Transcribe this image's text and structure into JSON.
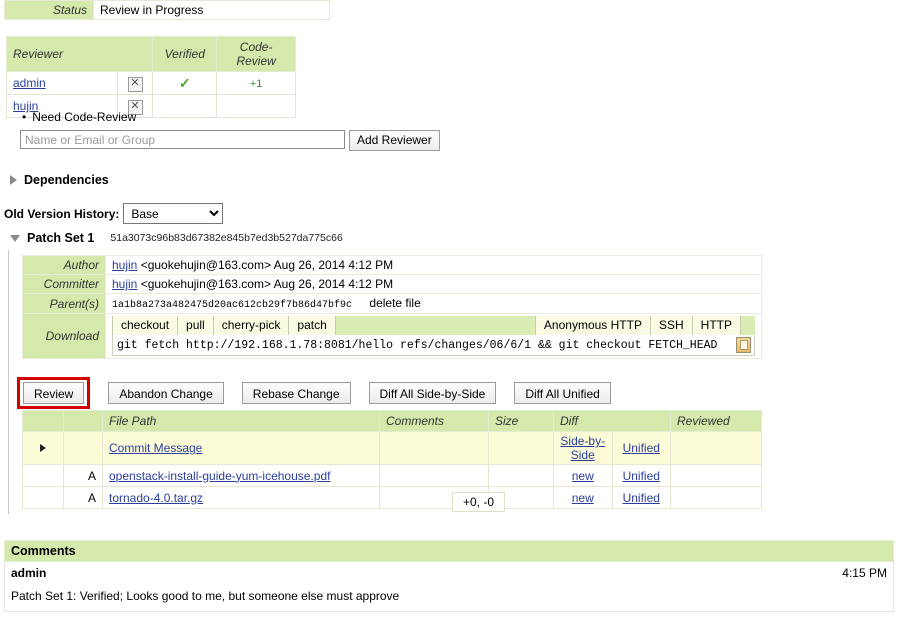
{
  "status": {
    "label": "Status",
    "value": "Review in Progress"
  },
  "reviewers": {
    "headers": {
      "reviewer": "Reviewer",
      "verified": "Verified",
      "code_review": "Code-Review"
    },
    "rows": [
      {
        "name": "admin",
        "remove": "✕",
        "verified": "✓",
        "code_review": "+1"
      },
      {
        "name": "hujin",
        "remove": "✕",
        "verified": "",
        "code_review": ""
      }
    ],
    "need_item": "Need Code-Review",
    "add_input_placeholder": "Name or Email or Group",
    "add_input_value": "",
    "add_button": "Add Reviewer"
  },
  "dependencies": {
    "label": "Dependencies"
  },
  "old_version": {
    "label": "Old Version History:",
    "selected": "Base",
    "options": [
      "Base"
    ]
  },
  "patch_set": {
    "title": "Patch Set 1",
    "sha": "51a3073c96b83d67382e845b7ed3b527da775c66",
    "author": {
      "label": "Author",
      "user": "hujin",
      "email": "<guokehujin@163.com>",
      "date": "Aug 26, 2014 4:12 PM"
    },
    "committer": {
      "label": "Committer",
      "user": "hujin",
      "email": "<guokehujin@163.com>",
      "date": "Aug 26, 2014 4:12 PM"
    },
    "parents": {
      "label": "Parent(s)",
      "sha": "1a1b8a273a482475d20ac612cb29f7b86d47bf9c",
      "message": "delete file"
    },
    "download": {
      "label": "Download",
      "command_tabs": [
        "checkout",
        "pull",
        "cherry-pick",
        "patch"
      ],
      "scheme_tabs": [
        "Anonymous HTTP",
        "SSH",
        "HTTP"
      ],
      "command": "git fetch http://192.168.1.78:8081/hello refs/changes/06/6/1 && git checkout FETCH_HEAD",
      "copy_icon": "clipboard-icon"
    }
  },
  "actions": {
    "review": "Review",
    "abandon": "Abandon Change",
    "rebase": "Rebase Change",
    "diff_side_by_side": "Diff All Side-by-Side",
    "diff_unified": "Diff All Unified",
    "highlight_color": "#d40000"
  },
  "files": {
    "headers": {
      "file_path": "File Path",
      "comments": "Comments",
      "size": "Size",
      "diff": "Diff",
      "reviewed": "Reviewed"
    },
    "rows": [
      {
        "expander": "▶",
        "status": "",
        "path": "Commit Message",
        "comments": "",
        "size": "",
        "diff1": "Side-by-Side",
        "diff2": "Unified",
        "reviewed": ""
      },
      {
        "expander": "",
        "status": "A",
        "path": "openstack-install-guide-yum-icehouse.pdf",
        "comments": "",
        "size": "",
        "diff1": "new",
        "diff2": "Unified",
        "reviewed": ""
      },
      {
        "expander": "",
        "status": "A",
        "path": "tornado-4.0.tar.gz",
        "comments": "",
        "size": "",
        "diff1": "new",
        "diff2": "Unified",
        "reviewed": ""
      }
    ],
    "totals": "+0, -0"
  },
  "comments": {
    "heading": "Comments",
    "entries": [
      {
        "author": "admin",
        "time": "4:15 PM",
        "body": "Patch Set 1: Verified; Looks good to me, but someone else must approve"
      }
    ]
  },
  "colors": {
    "header_green": "#d5e9ac",
    "row_yellow": "#fcfcd8",
    "link_blue": "#2b3f9e",
    "approve_green": "#4fa02a"
  }
}
